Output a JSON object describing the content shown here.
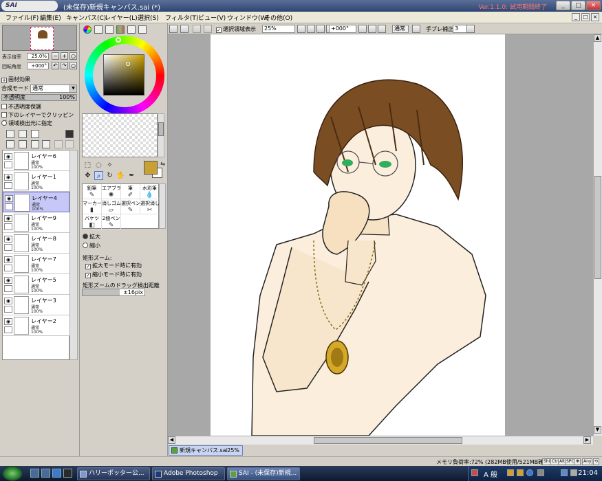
{
  "window": {
    "app_name": "SAI",
    "title": "(未保存)新規キャンバス.sai (*)",
    "version_notice": "Ver.1.1.0: 試用期間終了",
    "minimize": "_",
    "maximize": "□",
    "close": "×"
  },
  "menu": {
    "items": [
      "ファイル(F)",
      "編集(E)",
      "キャンバス(C)",
      "レイヤー(L)",
      "選択(S)",
      "フィルタ(T)",
      "ビュー(V)",
      "ウィンドウ(W)",
      "その他(O)"
    ]
  },
  "navigator": {
    "zoom_label": "表示倍率",
    "zoom_value": "25.0%",
    "rotation_label": "回転角度",
    "rotation_value": "+000°",
    "zoom_out": "−",
    "zoom_in": "+",
    "reset": "○",
    "rotate_left": "↶",
    "rotate_right": "↷"
  },
  "layer_panel": {
    "effects_label": "画材効果",
    "blend_mode_label": "合成モード",
    "blend_mode_value": "通常",
    "opacity_label": "不透明度",
    "opacity_value": "100%",
    "preserve_opacity": "不透明度保護",
    "clip_below": "下のレイヤーでクリッピング",
    "selection_source": "領域検出元に指定",
    "layers": [
      {
        "name": "レイヤー6",
        "mode": "通常",
        "opacity": "100%",
        "visible": true,
        "selected": false
      },
      {
        "name": "レイヤー1",
        "mode": "通常",
        "opacity": "100%",
        "visible": true,
        "selected": false
      },
      {
        "name": "レイヤー4",
        "mode": "通常",
        "opacity": "100%",
        "visible": true,
        "selected": true
      },
      {
        "name": "レイヤー9",
        "mode": "通常",
        "opacity": "100%",
        "visible": true,
        "selected": false
      },
      {
        "name": "レイヤー8",
        "mode": "通常",
        "opacity": "100%",
        "visible": true,
        "selected": false
      },
      {
        "name": "レイヤー7",
        "mode": "通常",
        "opacity": "100%",
        "visible": true,
        "selected": false
      },
      {
        "name": "レイヤー5",
        "mode": "通常",
        "opacity": "100%",
        "visible": true,
        "selected": false
      },
      {
        "name": "レイヤー3",
        "mode": "通常",
        "opacity": "100%",
        "visible": true,
        "selected": false
      },
      {
        "name": "レイヤー2",
        "mode": "通常",
        "opacity": "100%",
        "visible": true,
        "selected": false
      }
    ]
  },
  "tools": {
    "main_color": "#c8a033",
    "sub_color": "#ffffff",
    "brushes": [
      {
        "label": "鉛筆",
        "icon": "pencil-icon"
      },
      {
        "label": "エアブラシ",
        "icon": "airbrush-icon"
      },
      {
        "label": "筆",
        "icon": "brush-icon"
      },
      {
        "label": "水彩筆",
        "icon": "watercolor-icon"
      },
      {
        "label": "マーカー",
        "icon": "marker-icon"
      },
      {
        "label": "消しゴム",
        "icon": "eraser-icon"
      },
      {
        "label": "選択ペン",
        "icon": "select-pen-icon"
      },
      {
        "label": "選択消し",
        "icon": "select-erase-icon"
      },
      {
        "label": "バケツ",
        "icon": "bucket-icon"
      },
      {
        "label": "2値ペン",
        "icon": "binary-pen-icon"
      }
    ],
    "zoom_in_option": "拡大",
    "zoom_out_option": "縮小",
    "rect_zoom_label": "矩形ズーム:",
    "rect_zoom_in_enabled": "拡大モード時に有効",
    "rect_zoom_out_enabled": "縮小モード時に有効",
    "drag_threshold_label": "矩形ズームのドラッグ検出距離",
    "drag_threshold_value": "±16pix"
  },
  "canvas_toolbar": {
    "show_selection": "選択領域表示",
    "zoom_value": "25%",
    "rotation_value": "+000°",
    "mode_value": "通常",
    "stabilizer_label": "手ブレ補正",
    "stabilizer_value": "3"
  },
  "canvas_tab": {
    "name": "新規キャンバス.sai",
    "zoom": "25%"
  },
  "status": {
    "memory": "メモリ負荷率:72% (282MB使用/521MB確保)",
    "keys": [
      "Shift",
      "Ctrl",
      "Alt",
      "SPC",
      "✥",
      "Any",
      "⟲"
    ]
  },
  "taskbar": {
    "buttons": [
      {
        "label": "ハリーポッター公...",
        "active": false
      },
      {
        "label": "Adobe Photoshop",
        "active": false
      },
      {
        "label": "SAI - (未保存)新規...",
        "active": true
      }
    ],
    "ime": "A 般",
    "clock": "21:04"
  }
}
